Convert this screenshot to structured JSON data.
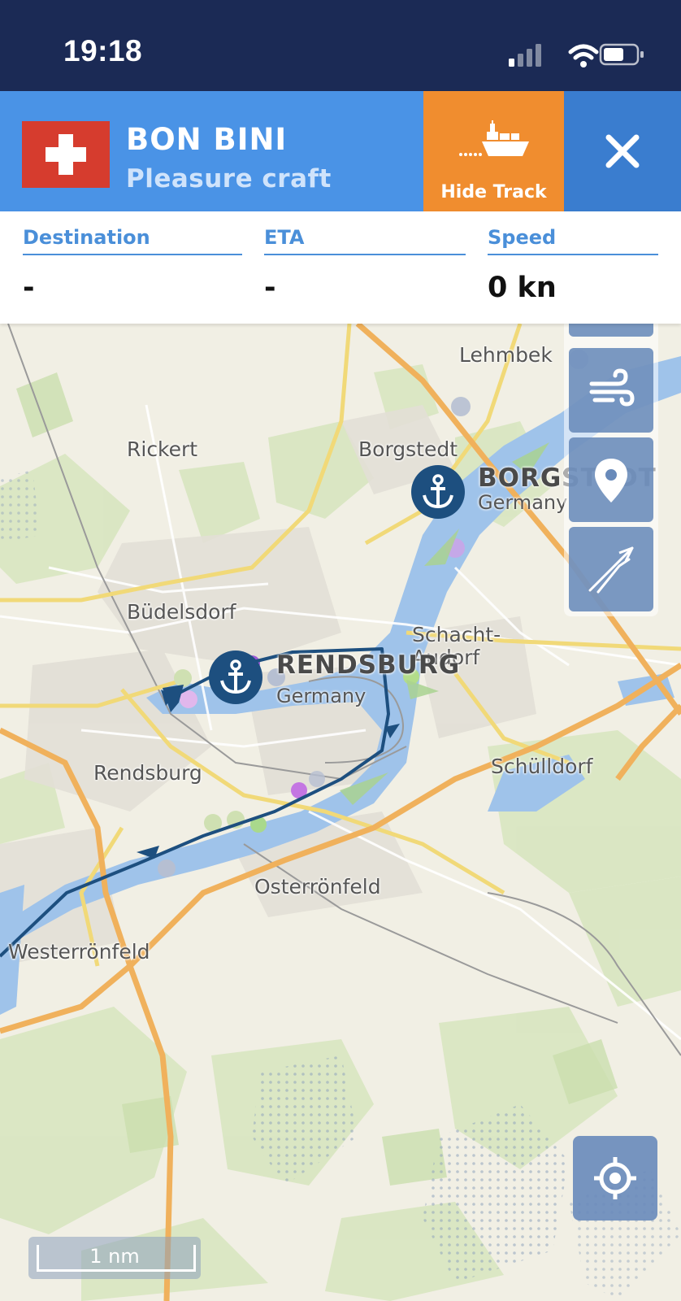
{
  "status_bar": {
    "time": "19:18"
  },
  "vessel": {
    "name": "BON BINI",
    "type": "Pleasure craft",
    "flag": "swiss-flag"
  },
  "actions": {
    "hide_track_label": "Hide Track",
    "hide_track_icon": "ship-track-icon",
    "close_icon": "close-icon"
  },
  "info": {
    "destination_label": "Destination",
    "destination_value": "-",
    "eta_label": "ETA",
    "eta_value": "-",
    "speed_label": "Speed",
    "speed_value": "0 kn"
  },
  "map": {
    "places": {
      "lehmbek": "Lehmbek",
      "rickert": "Rickert",
      "borgstedt": "Borgstedt",
      "budelsdorf": "Büdelsdorf",
      "schacht": "Schacht-",
      "audorf": "Audorf",
      "rendsburg": "Rendsburg",
      "schulldorf": "Schülldorf",
      "osterronfeld": "Osterrönfeld",
      "westerronfeld": "Westerrönfeld"
    },
    "ports": [
      {
        "name": "BORGSTEDT",
        "country": "Germany"
      },
      {
        "name": "RENDSBURG",
        "country": "Germany"
      }
    ],
    "side_buttons": [
      "wind-icon",
      "location-pin-icon",
      "compass-icon"
    ],
    "locate_icon": "crosshair-icon",
    "scale_label": "1 nm"
  },
  "colors": {
    "status_bar": "#1b2a55",
    "header": "#4a93e6",
    "hide_track": "#f08d2f",
    "close": "#3a7dcf",
    "track": "#1d4f7f",
    "water": "#9fc3ea"
  }
}
